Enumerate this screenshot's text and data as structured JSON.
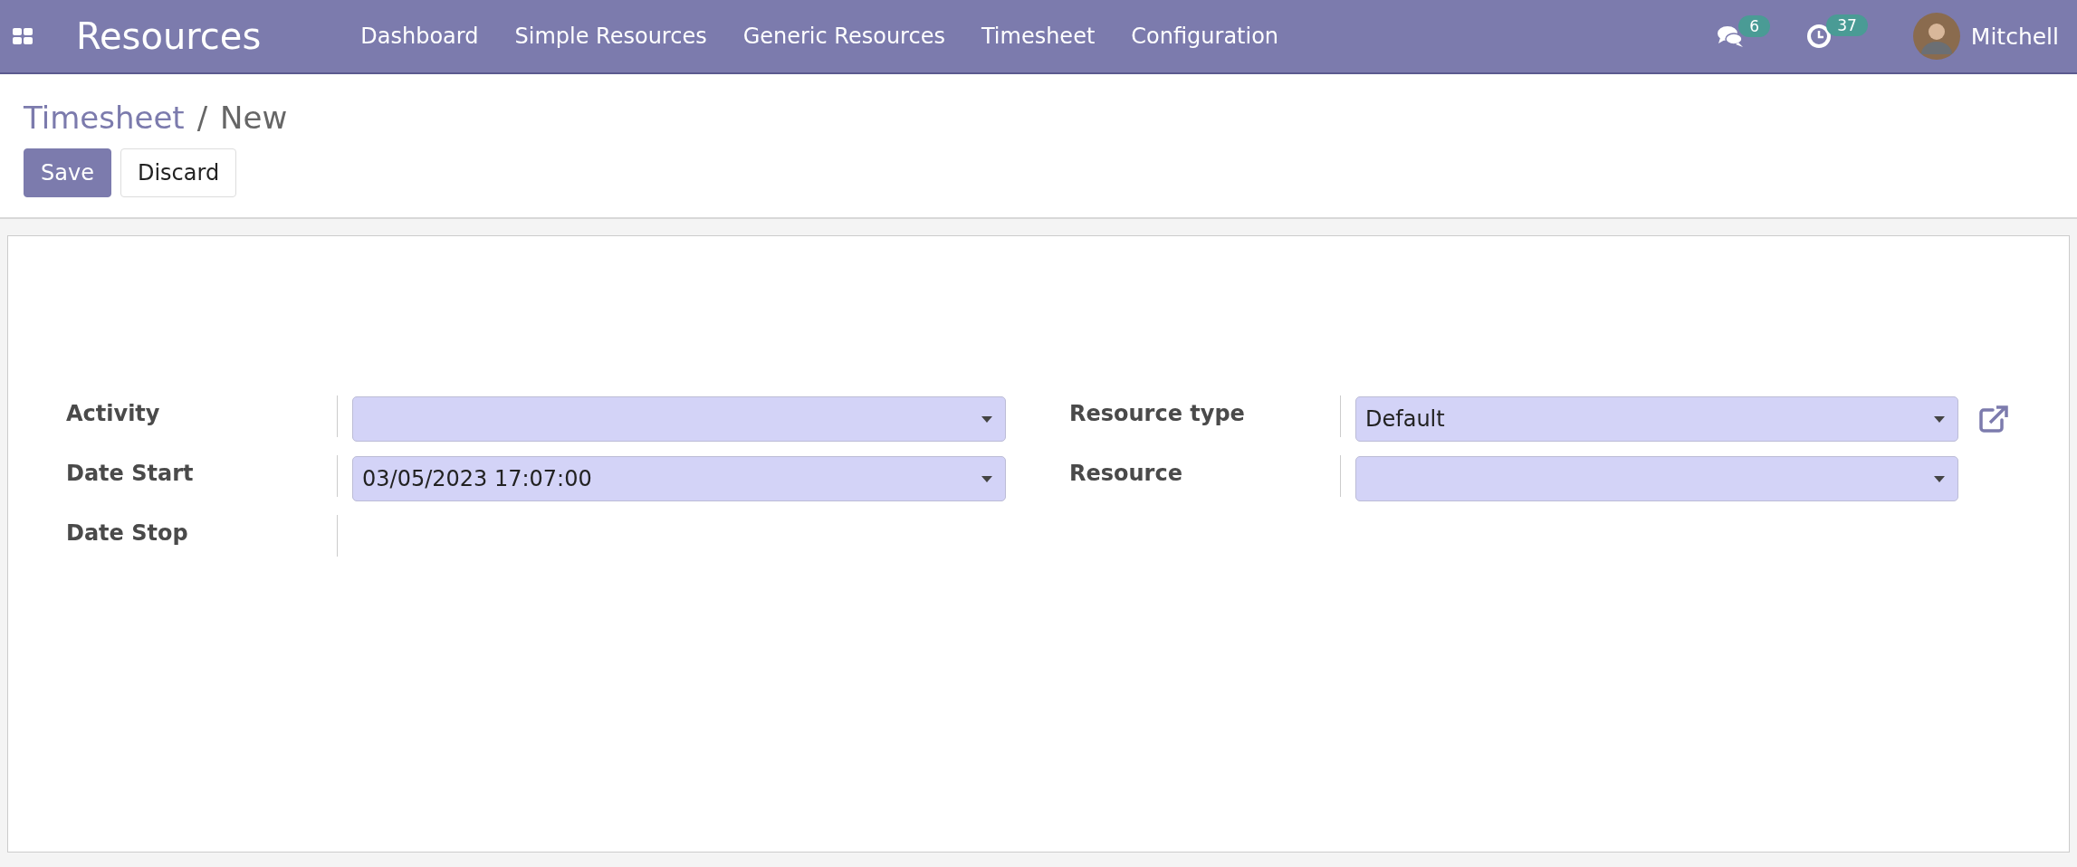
{
  "navbar": {
    "app_title": "Resources",
    "menu": [
      "Dashboard",
      "Simple Resources",
      "Generic Resources",
      "Timesheet",
      "Configuration"
    ],
    "messages_count": "6",
    "activities_count": "37",
    "user_name": "Mitchell"
  },
  "breadcrumb": {
    "parent": "Timesheet",
    "separator": "/",
    "current": "New"
  },
  "buttons": [
    {
      "label": "Save",
      "kind": "primary"
    },
    {
      "label": "Discard",
      "kind": "secondary"
    }
  ],
  "form": {
    "left_fields": [
      {
        "label": "Activity",
        "kind": "select"
      },
      {
        "label": "Date Start",
        "kind": "select",
        "value": "03/05/2023 17:07:00"
      },
      {
        "label": "Date Stop",
        "kind": "empty"
      }
    ],
    "right_fields": [
      {
        "label": "Resource type",
        "kind": "select",
        "value": "Default",
        "open_link": true
      },
      {
        "label": "Resource",
        "kind": "select",
        "open_link": false
      }
    ]
  }
}
